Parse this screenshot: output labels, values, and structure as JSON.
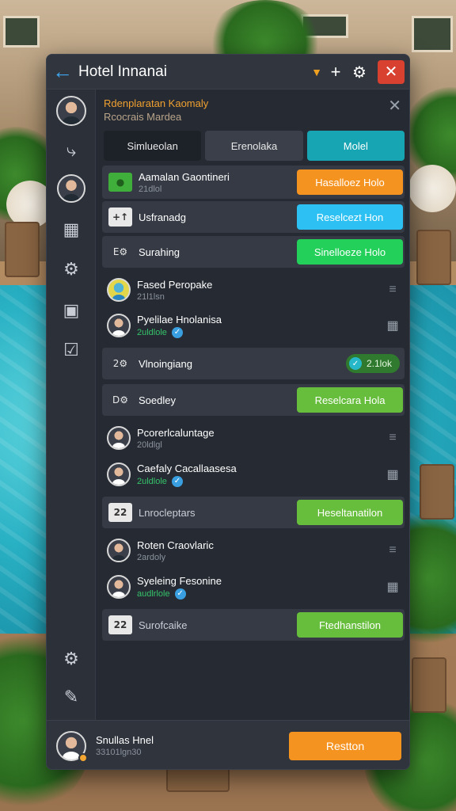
{
  "app": {
    "title": "Hotel Innanai",
    "icons": {
      "back": "arrow-left-icon",
      "dropdown": "chevron-down-icon",
      "add": "plus-icon",
      "settings": "gear-icon",
      "close": "close-icon"
    }
  },
  "banner": {
    "line1": "Rdenplaratan Kaomaly",
    "line2": "Rcocrais Mardea"
  },
  "tabs": [
    {
      "label": "Simlueolan",
      "style": "dark"
    },
    {
      "label": "Erenolaka",
      "style": "normal"
    },
    {
      "label": "Molel",
      "style": "active"
    }
  ],
  "rows": [
    {
      "kind": "card",
      "icon": "person-icon",
      "title": "Aamalan Gaontineri",
      "subtitle": "21dlol",
      "action": "Hasalloez Holo",
      "action_color": "#f59320"
    },
    {
      "kind": "card",
      "icon_text": "+↑",
      "title": "Usfranadg",
      "action": "Reselcezt Hon",
      "action_color": "#2cc1f2"
    },
    {
      "kind": "card",
      "icon_text": "E⚙",
      "title": "Surahing",
      "action": "Sinelloeze Holo",
      "action_color": "#22d05a"
    },
    {
      "kind": "person",
      "name": "Fased Peropake",
      "subtitle": "21l1lsn"
    },
    {
      "kind": "person",
      "name": "Pyelilae Hnolanisa",
      "subtitle": "2uldlole",
      "verified": true
    },
    {
      "kind": "card",
      "icon_text": "2⚙",
      "title": "Vlnoingiang",
      "pill": "2.1lok"
    },
    {
      "kind": "card",
      "icon_text": "D⚙",
      "title": "Soedley",
      "action": "Reselcara Hola",
      "action_color": "#67bd3c"
    },
    {
      "kind": "person",
      "name": "Pcorerlcaluntage",
      "subtitle": "20ldlgl"
    },
    {
      "kind": "person",
      "name": "Caefaly Cacallaasesa",
      "subtitle": "2uldlole",
      "verified": true
    },
    {
      "kind": "card",
      "icon_text": "22",
      "title": "Lnrocleptars",
      "action": "Heseltanatilon",
      "action_color": "#67bd3c"
    },
    {
      "kind": "person",
      "name": "Roten Craovlaric",
      "subtitle": "2ardoly"
    },
    {
      "kind": "person",
      "name": "Syeleing Fesonine",
      "subtitle": "audlrlole",
      "verified": true
    },
    {
      "kind": "card",
      "icon_text": "22",
      "title": "Surofcaike",
      "action": "Ftedhanstilon",
      "action_color": "#67bd3c"
    }
  ],
  "sidebar": {
    "items": [
      "profile-avatar",
      "share-icon",
      "contact-avatar",
      "list-grid-icon",
      "gear-icon",
      "chat-icon",
      "checklist-icon",
      "settings-gear-icon",
      "user-edit-icon"
    ]
  },
  "footer": {
    "name": "Snullas Hnel",
    "subtitle": "33101lgn30",
    "button": "Restton"
  }
}
